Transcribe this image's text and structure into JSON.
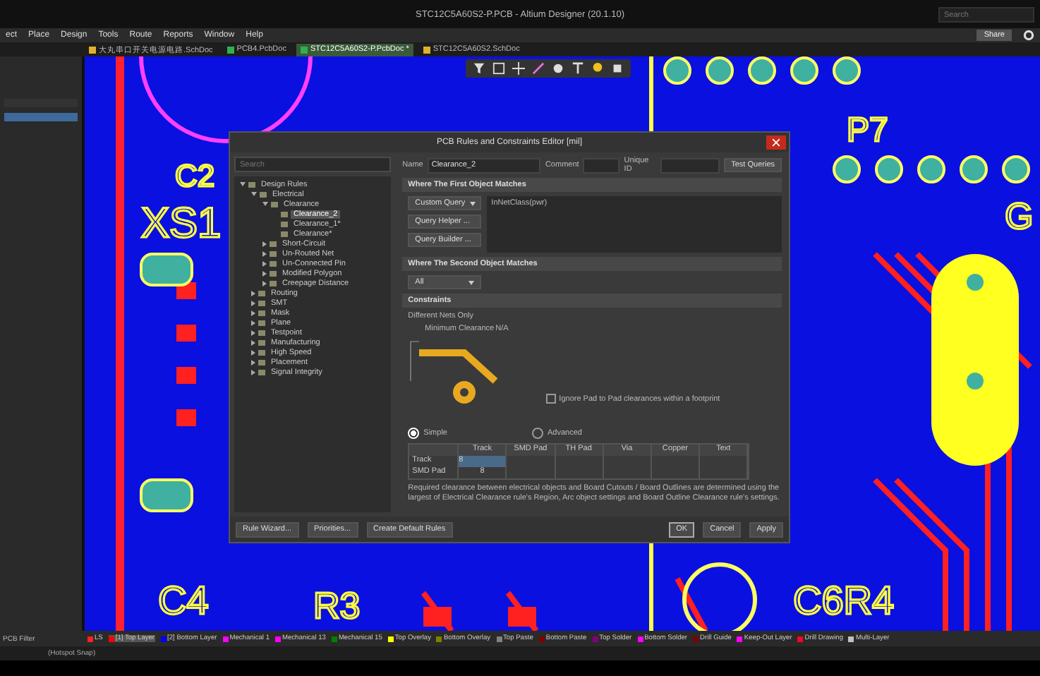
{
  "window": {
    "title": "STC12C5A60S2-P.PCB - Altium Designer (20.1.10)",
    "search_placeholder": "Search",
    "share_label": "Share"
  },
  "menu": [
    "ect",
    "Place",
    "Design",
    "Tools",
    "Route",
    "Reports",
    "Window",
    "Help"
  ],
  "document_tabs": [
    {
      "label": "大丸串口开关电源电路.SchDoc",
      "kind": "schematic",
      "selected": false
    },
    {
      "label": "PCB4.PcbDoc",
      "kind": "pcb",
      "selected": false
    },
    {
      "label": "STC12C5A60S2-P.PcbDoc *",
      "kind": "pcb",
      "selected": true
    },
    {
      "label": "STC12C5A60S2.SchDoc",
      "kind": "schematic",
      "selected": false
    }
  ],
  "pcb": {
    "designators": [
      "C2",
      "XS1",
      "P7",
      "G",
      "C4",
      "R3",
      "C6R4"
    ]
  },
  "dialog": {
    "title": "PCB Rules and Constraints Editor [mil]",
    "search_placeholder": "Search",
    "tree": [
      {
        "label": "Design Rules",
        "expanded": true,
        "selected": false,
        "children": [
          {
            "label": "Electrical",
            "expanded": true,
            "selected": false,
            "children": [
              {
                "label": "Clearance",
                "expanded": true,
                "selected": false,
                "children": [
                  {
                    "label": "Clearance_2",
                    "selected": true
                  },
                  {
                    "label": "Clearance_1*",
                    "selected": false
                  },
                  {
                    "label": "Clearance*",
                    "selected": false
                  }
                ]
              },
              {
                "label": "Short-Circuit",
                "expanded": false,
                "selected": false
              },
              {
                "label": "Un-Routed Net",
                "expanded": false,
                "selected": false
              },
              {
                "label": "Un-Connected Pin",
                "expanded": false,
                "selected": false
              },
              {
                "label": "Modified Polygon",
                "expanded": false,
                "selected": false
              },
              {
                "label": "Creepage Distance",
                "expanded": false,
                "selected": false
              }
            ]
          },
          {
            "label": "Routing",
            "expanded": false,
            "selected": false
          },
          {
            "label": "SMT",
            "expanded": false,
            "selected": false
          },
          {
            "label": "Mask",
            "expanded": false,
            "selected": false
          },
          {
            "label": "Plane",
            "expanded": false,
            "selected": false
          },
          {
            "label": "Testpoint",
            "expanded": false,
            "selected": false
          },
          {
            "label": "Manufacturing",
            "expanded": false,
            "selected": false
          },
          {
            "label": "High Speed",
            "expanded": false,
            "selected": false
          },
          {
            "label": "Placement",
            "expanded": false,
            "selected": false
          },
          {
            "label": "Signal Integrity",
            "expanded": false,
            "selected": false
          }
        ]
      }
    ],
    "name_label": "Name",
    "name_value": "Clearance_2",
    "comment_label": "Comment",
    "unique_id_label": "Unique ID",
    "test_queries": "Test Queries",
    "first_match": {
      "header": "Where The First Object Matches",
      "query_type": "Custom Query",
      "query_helper": "Query Helper ...",
      "query_builder": "Query Builder ...",
      "query": "InNetClass(pwr)"
    },
    "second_match": {
      "header": "Where The Second Object Matches",
      "query_type": "All"
    },
    "constraints": {
      "header": "Constraints",
      "different_nets": "Different Nets Only",
      "minimum_clearance": "Minimum Clearance",
      "clearance_value": "N/A",
      "ignore_pad": {
        "label": "Ignore Pad to Pad clearances within a footprint",
        "checked": false
      },
      "modes": [
        {
          "label": "Simple",
          "selected": true
        },
        {
          "label": "Advanced",
          "selected": false
        }
      ],
      "table": {
        "columns": [
          "Track",
          "SMD Pad",
          "TH Pad",
          "Via",
          "Copper",
          "Text"
        ],
        "rows": [
          {
            "label": "Track",
            "cells": [
              "8",
              "",
              "",
              "",
              "",
              ""
            ]
          },
          {
            "label": "SMD Pad",
            "cells": [
              "8",
              "",
              "",
              "",
              "",
              ""
            ]
          }
        ]
      },
      "note": "Required clearance between electrical objects and Board Cutouts / Board Outlines are determined using the largest of Electrical Clearance rule's Region, Arc object settings and Board Outline Clearance rule's settings."
    },
    "buttons_left": [
      "Rule Wizard...",
      "Priorities...",
      "Create Default Rules"
    ],
    "buttons_right": [
      {
        "label": "OK",
        "selected": true
      },
      {
        "label": "Cancel",
        "selected": false
      },
      {
        "label": "Apply",
        "selected": false
      }
    ]
  },
  "layers": [
    {
      "label": "LS",
      "color": "#ff2020",
      "selected": false
    },
    {
      "label": "[1] Top Layer",
      "color": "#ff0000",
      "selected": true
    },
    {
      "label": "[2] Bottom Layer",
      "color": "#0000ff",
      "selected": false
    },
    {
      "label": "Mechanical 1",
      "color": "#ff00ff",
      "selected": false
    },
    {
      "label": "Mechanical 13",
      "color": "#ff00ff",
      "selected": false
    },
    {
      "label": "Mechanical 15",
      "color": "#008000",
      "selected": false
    },
    {
      "label": "Top Overlay",
      "color": "#ffff00",
      "selected": false
    },
    {
      "label": "Bottom Overlay",
      "color": "#808000",
      "selected": false
    },
    {
      "label": "Top Paste",
      "color": "#808080",
      "selected": false
    },
    {
      "label": "Bottom Paste",
      "color": "#800000",
      "selected": false
    },
    {
      "label": "Top Solder",
      "color": "#800080",
      "selected": false
    },
    {
      "label": "Bottom Solder",
      "color": "#ff00ff",
      "selected": false
    },
    {
      "label": "Drill Guide",
      "color": "#800000",
      "selected": false
    },
    {
      "label": "Keep-Out Layer",
      "color": "#ff00ff",
      "selected": false
    },
    {
      "label": "Drill Drawing",
      "color": "#ff002a",
      "selected": false
    },
    {
      "label": "Multi-Layer",
      "color": "#c0c0c0",
      "selected": false
    }
  ],
  "left_panel": {
    "footer": "PCB Filter"
  },
  "status_bar": {
    "snap": "(Hotspot Snap)"
  }
}
